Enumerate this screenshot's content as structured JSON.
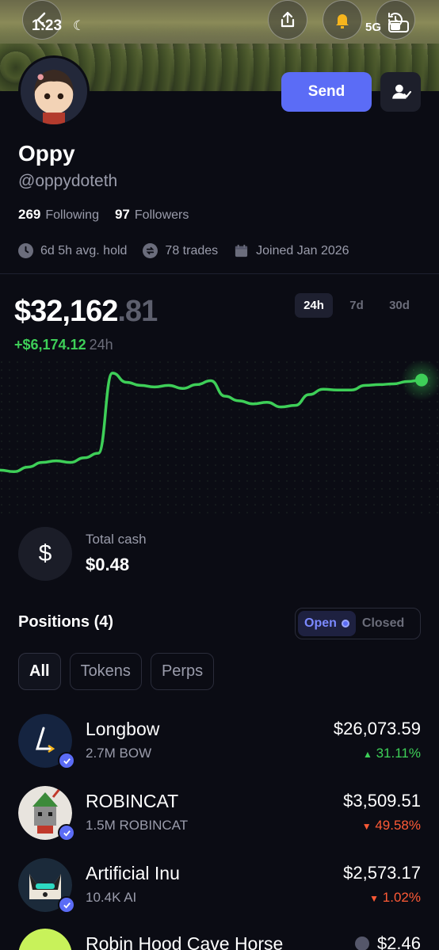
{
  "status_bar": {
    "time": "1:23",
    "network": "5G"
  },
  "profile": {
    "name": "Oppy",
    "handle": "@oppydoteth",
    "following_count": "269",
    "following_label": "Following",
    "followers_count": "97",
    "followers_label": "Followers",
    "avg_hold": "6d 5h avg. hold",
    "trades": "78 trades",
    "joined": "Joined Jan 2026",
    "send_label": "Send"
  },
  "portfolio": {
    "balance_main": "$32,162",
    "balance_cents": ".81",
    "change": "+$6,174.12",
    "change_period": "24h",
    "ranges": [
      "24h",
      "7d",
      "30d"
    ],
    "active_range": "24h"
  },
  "chart_data": {
    "type": "line",
    "title": "",
    "xlabel": "",
    "ylabel": "",
    "x": [
      0,
      1,
      2,
      3,
      4,
      5,
      6,
      7,
      8,
      9,
      10,
      11,
      12,
      13,
      14,
      15,
      16,
      17,
      18,
      19,
      20,
      21,
      22,
      23,
      24,
      25,
      26,
      27,
      28,
      29,
      30
    ],
    "values": [
      25800,
      25700,
      26000,
      26300,
      26400,
      26300,
      26600,
      26900,
      32100,
      31500,
      31300,
      31200,
      31300,
      31100,
      31350,
      31600,
      30600,
      30300,
      30100,
      30200,
      29900,
      30000,
      30700,
      31050,
      31000,
      31000,
      31300,
      31350,
      31400,
      31550,
      31650
    ],
    "line_color": "#3ecf58",
    "grid": false
  },
  "cash": {
    "label": "Total cash",
    "value": "$0.48"
  },
  "positions": {
    "title": "Positions (4)",
    "toggle": [
      "Open",
      "Closed"
    ],
    "filters": [
      "All",
      "Tokens",
      "Perps"
    ],
    "items": [
      {
        "name": "Longbow",
        "qty": "2.7M BOW",
        "value": "$26,073.59",
        "change": "31.11%",
        "direction": "up"
      },
      {
        "name": "ROBINCAT",
        "qty": "1.5M ROBINCAT",
        "value": "$3,509.51",
        "change": "49.58%",
        "direction": "down"
      },
      {
        "name": "Artificial Inu",
        "qty": "10.4K AI",
        "value": "$2,573.17",
        "change": "1.02%",
        "direction": "down"
      },
      {
        "name": "Robin Hood Cave Horse",
        "qty": "",
        "value": "$2.46",
        "change": "",
        "direction": "down"
      }
    ]
  },
  "colors": {
    "accent": "#5b6cf6",
    "positive": "#3ecf58",
    "negative": "#ff5a36",
    "background": "#0b0c14"
  },
  "icons": [
    "back-icon",
    "share-icon",
    "bell-icon",
    "history-icon",
    "follow-icon",
    "clock-icon",
    "swap-icon",
    "calendar-icon",
    "dollar-icon",
    "verified-icon"
  ]
}
